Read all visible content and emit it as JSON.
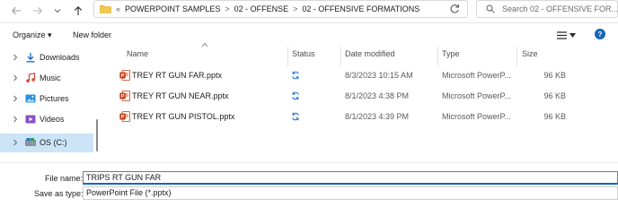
{
  "address": {
    "overflow_glyph": "«",
    "breadcrumbs": [
      "POWERPOINT SAMPLES",
      "02 - OFFENSE",
      "02 - OFFENSIVE FORMATIONS"
    ],
    "separator": ">"
  },
  "search": {
    "placeholder": "Search 02 - OFFENSIVE FOR..."
  },
  "commandbar": {
    "organize_label": "Organize ▾",
    "new_folder_label": "New folder"
  },
  "navigation": {
    "items": [
      {
        "label": "Downloads",
        "icon": "download-arrow-icon",
        "color": "#1e73d8"
      },
      {
        "label": "Music",
        "icon": "music-note-icon",
        "color": "#e1453a"
      },
      {
        "label": "Pictures",
        "icon": "pictures-icon",
        "color": "#2d8fe0"
      },
      {
        "label": "Videos",
        "icon": "videos-icon",
        "color": "#8a4fc9"
      },
      {
        "label": "OS (C:)",
        "icon": "drive-icon",
        "color": "#5a6470",
        "selected": true
      }
    ]
  },
  "columns": {
    "name": "Name",
    "status": "Status",
    "date": "Date modified",
    "type": "Type",
    "size": "Size"
  },
  "files": [
    {
      "name": "TREY RT GUN FAR.pptx",
      "status_icon": "sync-icon",
      "date": "8/3/2023 10:15 AM",
      "type": "Microsoft PowerP...",
      "size": "96 KB"
    },
    {
      "name": "TREY RT GUN NEAR.pptx",
      "status_icon": "sync-icon",
      "date": "8/1/2023 4:38 PM",
      "type": "Microsoft PowerP...",
      "size": "96 KB"
    },
    {
      "name": "TREY RT GUN PISTOL.pptx",
      "status_icon": "sync-icon",
      "date": "8/1/2023 4:39 PM",
      "type": "Microsoft PowerP...",
      "size": "96 KB"
    }
  ],
  "fields": {
    "file_name_label": "File name:",
    "file_name_value": "TRIPS RT GUN FAR",
    "save_as_type_label": "Save as type:",
    "save_as_type_value": "PowerPoint File (*.pptx)"
  },
  "colors": {
    "accent": "#1466b8",
    "selection": "#cce4f7",
    "sync": "#1e73d8",
    "pptx": "#c43e1c"
  }
}
